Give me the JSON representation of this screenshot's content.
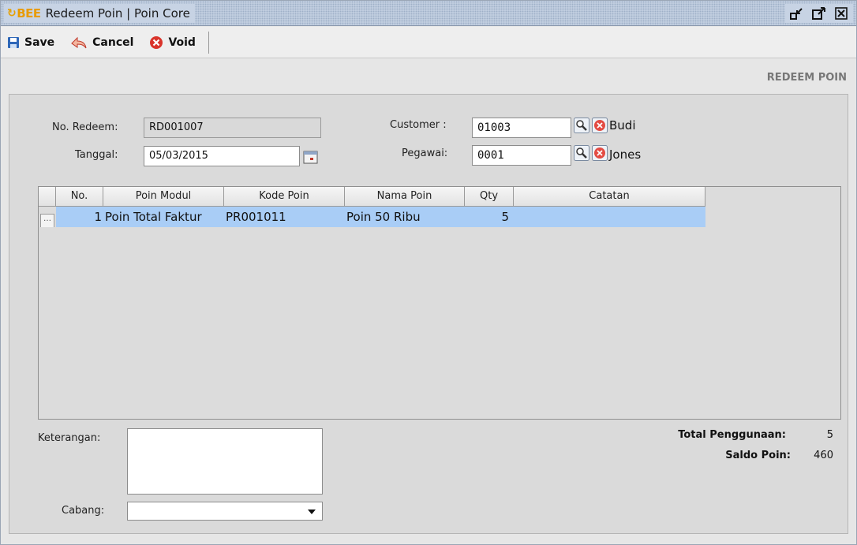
{
  "window": {
    "title": "Redeem Poin | Poin Core",
    "logo_text": "BEE"
  },
  "toolbar": {
    "save_label": "Save",
    "cancel_label": "Cancel",
    "void_label": "Void"
  },
  "page": {
    "header": "REDEEM POIN"
  },
  "form": {
    "no_redeem_label": "No. Redeem:",
    "no_redeem_value": "RD001007",
    "tanggal_label": "Tanggal:",
    "tanggal_value": "05/03/2015",
    "customer_label": "Customer :",
    "customer_code": "01003",
    "customer_name": "Budi",
    "pegawai_label": "Pegawai:",
    "pegawai_code": "0001",
    "pegawai_name": "Jones"
  },
  "grid": {
    "columns": [
      "No.",
      "Poin Modul",
      "Kode Poin",
      "Nama Poin",
      "Qty",
      "Catatan"
    ],
    "rows": [
      {
        "no": "1",
        "modul": "Poin Total Faktur",
        "kode": "PR001011",
        "nama": "Poin 50 Ribu",
        "qty": "5",
        "catatan": ""
      }
    ]
  },
  "footer": {
    "keterangan_label": "Keterangan:",
    "keterangan_value": "",
    "cabang_label": "Cabang:",
    "cabang_value": "",
    "total_label": "Total Penggunaan:",
    "total_value": "5",
    "saldo_label": "Saldo Poin:",
    "saldo_value": "460"
  },
  "colors": {
    "selected_row": "#a9cdf6",
    "titlebar": "#c7d3e4"
  }
}
